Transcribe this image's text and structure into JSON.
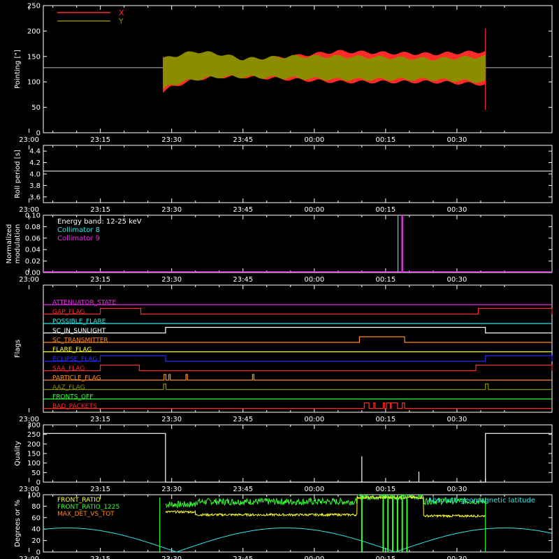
{
  "colors": {
    "background": "#000000",
    "axis": "#ffffff",
    "red": "#ff2a2a",
    "olive": "#8c8c00",
    "cyan": "#2ee6e6",
    "magenta": "#e62ee6",
    "yellow": "#ffff33",
    "green": "#33ff33",
    "orange": "#ff8c1a",
    "blue": "#2a2aff",
    "white": "#ffffff"
  },
  "time_ticks": [
    "23:00",
    "23:15",
    "23:30",
    "23:45",
    "00:00",
    "00:15",
    "00:30"
  ],
  "chart_data": [
    {
      "id": "pointing",
      "type": "line",
      "ylabel": "Pointing [\"]",
      "ylim": [
        0,
        250
      ],
      "yticks": [
        "0",
        "50",
        "100",
        "150",
        "200",
        "250"
      ],
      "legend": [
        {
          "label": "X",
          "color": "red"
        },
        {
          "label": "Y",
          "color": "olive"
        }
      ],
      "baseline": 128,
      "active_window_min": [
        13.2,
        81.0
      ],
      "series": [
        {
          "name": "X",
          "color": "red",
          "envelope_min": [
            13.2,
            15,
            20,
            25,
            30,
            40,
            50,
            60,
            70,
            81
          ],
          "envelope_upper": [
            150,
            140,
            130,
            135,
            140,
            150,
            160,
            157,
            155,
            160
          ],
          "envelope_lower": [
            80,
            90,
            105,
            110,
            110,
            105,
            100,
            100,
            100,
            95
          ],
          "spike": [
            81,
            205,
            45
          ]
        },
        {
          "name": "Y",
          "color": "olive",
          "envelope_min": [
            13.2,
            15,
            20,
            25,
            30,
            40,
            50,
            60,
            70,
            81
          ],
          "envelope_upper": [
            145,
            150,
            160,
            155,
            145,
            150,
            150,
            148,
            145,
            150
          ],
          "envelope_lower": [
            85,
            95,
            105,
            110,
            110,
            108,
            105,
            105,
            105,
            100
          ]
        }
      ]
    },
    {
      "id": "roll",
      "type": "line",
      "ylabel": "Roll period [s]",
      "ylim": [
        3.5,
        4.5
      ],
      "yticks": [
        "3.6",
        "3.8",
        "4.0",
        "4.2",
        "4.4"
      ],
      "value": 4.05
    },
    {
      "id": "modulation",
      "type": "line",
      "ylabel": "Normalized modulation",
      "ylabel_lines": [
        "Normalized",
        "modulation"
      ],
      "ylim": [
        0,
        0.1
      ],
      "yticks": [
        "0.00",
        "0.02",
        "0.04",
        "0.06",
        "0.08",
        "0.10"
      ],
      "legend": [
        {
          "label": "Energy band: 12-25 keV",
          "color": "white"
        },
        {
          "label": "Collimator 8",
          "color": "cyan"
        },
        {
          "label": "Collimator 9",
          "color": "magenta"
        }
      ],
      "spikes": [
        {
          "color": "cyan",
          "x": 62.6
        },
        {
          "color": "magenta",
          "x": 63.5
        }
      ]
    },
    {
      "id": "flags",
      "type": "line",
      "ylabel": "Flags",
      "series": [
        {
          "name": "ATTENUATOR_STATE",
          "color": "magenta",
          "segments": []
        },
        {
          "name": "GAP_FLAG",
          "color": "red",
          "segments": [
            [
              0,
              8.5
            ],
            [
              79.5,
              95
            ]
          ]
        },
        {
          "name": "POSSIBLE_FLARE",
          "color": "cyan",
          "segments": []
        },
        {
          "name": "SC_IN_SUNLIGHT",
          "color": "white",
          "segments": [
            [
              13.7,
              81
            ]
          ]
        },
        {
          "name": "SC_TRANSMITTER",
          "color": "orange",
          "segments": [
            [
              54.5,
              64
            ]
          ]
        },
        {
          "name": "FLARE_FLAG",
          "color": "yellow",
          "segments": []
        },
        {
          "name": "ECLIPSE_FLAG",
          "color": "blue",
          "segments": [
            [
              0,
              13.7
            ],
            [
              81,
              95
            ]
          ]
        },
        {
          "name": "SAA_FLAG",
          "color": "red",
          "segments": [
            [
              0,
              8.2
            ],
            [
              79,
              95
            ]
          ]
        },
        {
          "name": "PARTICLE_FLAG",
          "color": "orange",
          "segments": [
            [
              13.4,
              13.8
            ],
            [
              14.4,
              14.7
            ],
            [
              18.0,
              18.3
            ],
            [
              32.0,
              32.3
            ]
          ]
        },
        {
          "name": "AAZ_FLAG",
          "color": "olive",
          "segments": [
            [
              13.3,
              13.8
            ],
            [
              81.0,
              81.6
            ]
          ]
        },
        {
          "name": "FRONTS_OFF",
          "color": "green",
          "segments": []
        },
        {
          "name": "BAD_PACKETS",
          "color": "red",
          "segments": [
            [
              55.5,
              56.5
            ],
            [
              57.5,
              57.8
            ],
            [
              59.5,
              59.8
            ],
            [
              60.2,
              61.0
            ],
            [
              61.2,
              62.5
            ],
            [
              63.5,
              64.0
            ]
          ]
        }
      ]
    },
    {
      "id": "quality",
      "type": "line",
      "ylabel": "Quality",
      "ylim": [
        0,
        300
      ],
      "yticks": [
        "0",
        "50",
        "100",
        "150",
        "200",
        "250",
        "300"
      ],
      "high_segments": [
        [
          0,
          13.7
        ],
        [
          81,
          95
        ]
      ],
      "high_value": 255,
      "spikes": [
        [
          55.0,
          135
        ],
        [
          67.0,
          55
        ],
        [
          81.0,
          20
        ]
      ]
    },
    {
      "id": "ratios",
      "type": "line",
      "ylabel": "Degrees or %",
      "ylim": [
        0,
        100
      ],
      "yticks": [
        "0",
        "20",
        "40",
        "60",
        "80",
        "100"
      ],
      "legend_left": [
        {
          "label": "FRONT_RATIO",
          "color": "yellow"
        },
        {
          "label": "FRONT_RATIO_1225",
          "color": "green"
        },
        {
          "label": "MAX_DET_VS_TOT",
          "color": "orange"
        }
      ],
      "legend_right": {
        "label": "Absolute geomagnetic latitude",
        "color": "cyan"
      },
      "geomag_peaks_min": [
        -7,
        39,
        85
      ],
      "geomag_peak_value": 42,
      "front_ratio_steps": [
        [
          13.7,
          20,
          83
        ],
        [
          20,
          54,
          88
        ],
        [
          54,
          68,
          97
        ],
        [
          68,
          81,
          89
        ]
      ],
      "max_det_steps": [
        [
          13.7,
          20,
          70
        ],
        [
          20,
          54,
          65
        ],
        [
          54,
          68,
          95
        ],
        [
          68,
          81,
          63
        ]
      ],
      "dropouts_min": [
        12.5,
        81.0,
        55.0,
        59.5,
        60.5,
        61.5,
        62.5,
        63.5,
        64.5
      ]
    }
  ]
}
